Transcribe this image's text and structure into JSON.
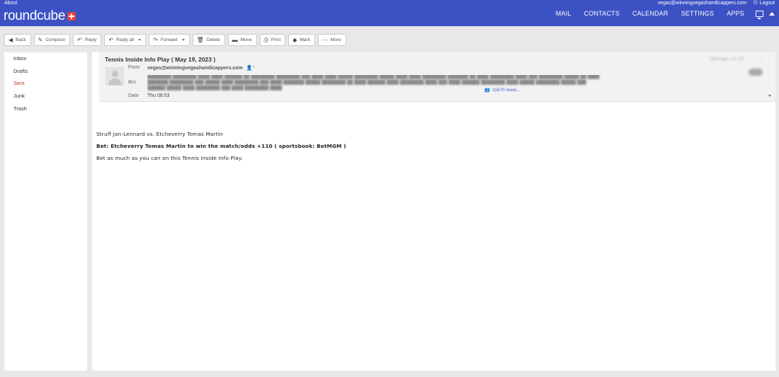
{
  "topbar": {
    "about": "About",
    "user_email": "vegas@winningvegashandicappers.com",
    "logout": "Logout",
    "logo_text": "roundcube",
    "nav": [
      "MAIL",
      "CONTACTS",
      "CALENDAR",
      "SETTINGS",
      "APPS"
    ]
  },
  "toolbar": {
    "back": "Back",
    "compose": "Compose",
    "reply": "Reply",
    "reply_all": "Reply all",
    "forward": "Forward",
    "delete": "Delete",
    "move": "Move",
    "print": "Print",
    "mark": "Mark",
    "more": "More"
  },
  "folders": [
    {
      "label": "Inbox",
      "active": false
    },
    {
      "label": "Drafts",
      "active": false
    },
    {
      "label": "Sent",
      "active": true
    },
    {
      "label": "Junk",
      "active": false
    },
    {
      "label": "Trash",
      "active": false
    }
  ],
  "message": {
    "subject": "Tennis Inside Info Play ( May 19, 2023 )",
    "counter": "Message 1 of 730",
    "from_label": "From",
    "from_value": "vegas@winningvegashandicappers.com",
    "bcc_label": "Bcc",
    "date_label": "Date",
    "date_value": "Thu 08:53",
    "more_recipients": "11670 more...",
    "body": {
      "line1": "Struff Jan-Lennard vs. Etcheverry Tomas Martin",
      "line2": "Bet: Etcheverry Tomas Martin to win the match/odds +110 ( sportsbook: BetMGM )",
      "line3": "Bet as much as you can on this Tennis Inside Info Play."
    }
  },
  "colors": {
    "topbar": "#3c52c4",
    "logo_plus": "#e2403c",
    "active_folder": "#c0392b",
    "link": "#3c52c4"
  }
}
